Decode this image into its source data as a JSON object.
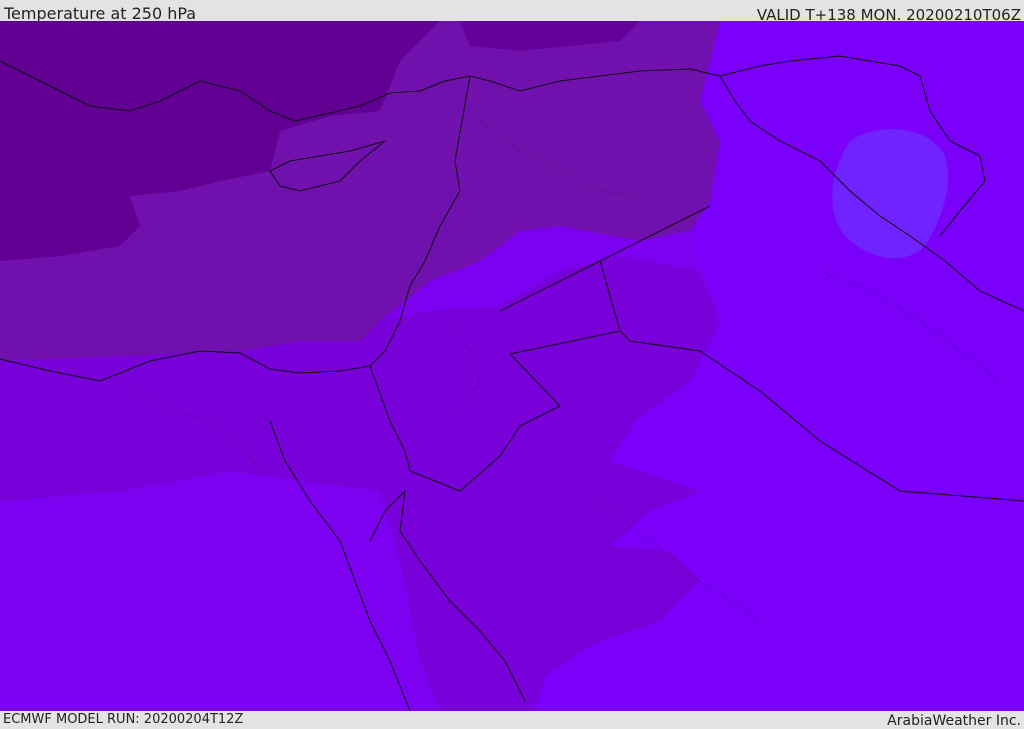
{
  "header": {
    "title": "Temperature at 250 hPa",
    "valid_time": "VALID T+138 MON. 20200210T06Z"
  },
  "footer": {
    "model_run": "ECMWF MODEL RUN: 20200204T12Z",
    "credit": "ArabiaWeather Inc."
  },
  "map": {
    "colors": {
      "coldest": "#610093",
      "cold": "#7010ad",
      "cool": "#7800d8",
      "mild": "#7d00f0",
      "warmest": "#7022ff",
      "land_outline": "#111111"
    }
  }
}
